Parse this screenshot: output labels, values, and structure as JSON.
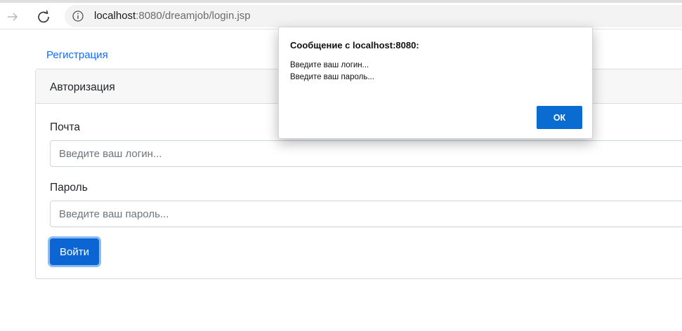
{
  "browser": {
    "url_host": "localhost",
    "url_rest": ":8080/dreamjob/login.jsp",
    "icons": {
      "forward": "arrow-right-icon",
      "reload": "reload-icon",
      "info": "info-icon"
    }
  },
  "page": {
    "register_link": "Регистрация",
    "card_title": "Авторизация",
    "email_label": "Почта",
    "email_placeholder": "Введите ваш логин...",
    "password_label": "Пароль",
    "password_placeholder": "Введите ваш пароль...",
    "login_button": "Войти"
  },
  "dialog": {
    "title": "Сообщение с localhost:8080:",
    "lines": [
      "Введите ваш логин...",
      "Введите ваш пароль..."
    ],
    "ok_label": "ОК"
  },
  "colors": {
    "link": "#0d6efd",
    "primary_button": "#0b66d4",
    "dialog_button": "#0a6cd1"
  }
}
